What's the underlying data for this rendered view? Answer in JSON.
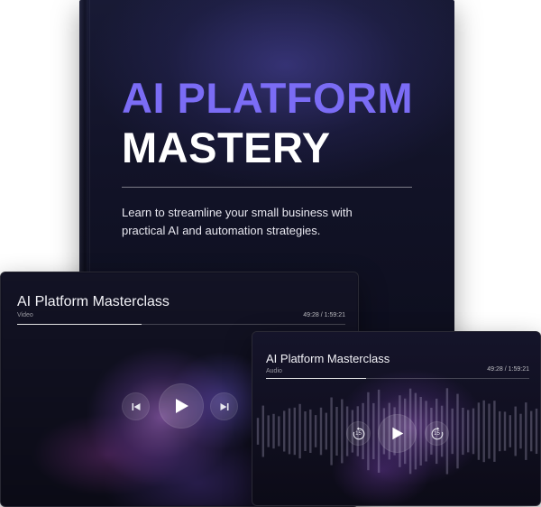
{
  "book": {
    "title_line1": "AI PLATFORM",
    "title_line2": "MASTERY",
    "subtitle": "Learn to streamline your small business with practical AI and automation strategies.",
    "accent_color": "#7b6cf5"
  },
  "video_player": {
    "title": "AI Platform Masterclass",
    "kind": "Video",
    "time": "49:28 / 1:59:21",
    "progress": 0.38,
    "controls": {
      "previous_icon": "skip-previous-icon",
      "play_icon": "play-icon",
      "next_icon": "skip-next-icon"
    }
  },
  "audio_player": {
    "title": "AI Platform Masterclass",
    "kind": "Audio",
    "time": "49:28 / 1:59:21",
    "progress": 0.38,
    "controls": {
      "rewind_label": "15",
      "rewind_icon": "rewind-15-icon",
      "play_icon": "play-icon",
      "forward_label": "15",
      "forward_icon": "forward-15-icon"
    }
  }
}
